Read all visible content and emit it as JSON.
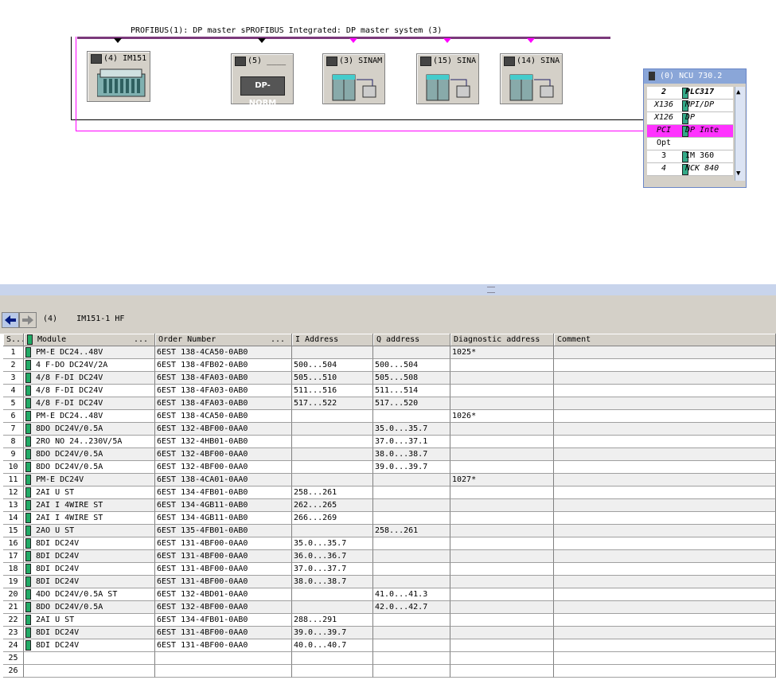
{
  "network": {
    "bus_label": "PROFIBUS(1): DP master sPROFIBUS Integrated: DP master system (3)",
    "stations": [
      {
        "id": "im151",
        "title": "(4) IM151"
      },
      {
        "id": "dpnorm",
        "title": "(5) ____",
        "badge": "DP-NORM"
      },
      {
        "id": "sinam",
        "title": "(3) SINAM"
      },
      {
        "id": "sina15",
        "title": "(15) SINA"
      },
      {
        "id": "sina14",
        "title": "(14) SINA"
      }
    ],
    "plc": {
      "title": "(0) NCU 730.2",
      "rows": [
        {
          "slot": "2",
          "name": "PLC317"
        },
        {
          "slot": "X136",
          "name": "MPI/DP"
        },
        {
          "slot": "X126",
          "name": "DP"
        },
        {
          "slot": "PCI",
          "name": "DP Inte"
        },
        {
          "slot": "Opt",
          "name": ""
        },
        {
          "slot": "3",
          "name": "IM 360"
        },
        {
          "slot": "4",
          "name": "NCK 840"
        }
      ]
    }
  },
  "detail": {
    "slot_number": "(4)",
    "station_name": "IM151-1 HF",
    "columns": [
      "S...",
      "Module",
      "...",
      "Order Number",
      "...",
      "I Address",
      "Q address",
      "Diagnostic address",
      "Comment"
    ],
    "rows": [
      {
        "slot": "1",
        "module": "PM-E DC24..48V",
        "order": "6EST 138-4CA50-0AB0",
        "i": "",
        "q": "",
        "diag": "1025*"
      },
      {
        "slot": "2",
        "module": "4 F-DO DC24V/2A",
        "order": "6EST 138-4FB02-0AB0",
        "i": "500...504",
        "q": "500...504",
        "diag": ""
      },
      {
        "slot": "3",
        "module": "4/8 F-DI DC24V",
        "order": "6EST 138-4FA03-0AB0",
        "i": "505...510",
        "q": "505...508",
        "diag": ""
      },
      {
        "slot": "4",
        "module": "4/8 F-DI DC24V",
        "order": "6EST 138-4FA03-0AB0",
        "i": "511...516",
        "q": "511...514",
        "diag": ""
      },
      {
        "slot": "5",
        "module": "4/8 F-DI DC24V",
        "order": "6EST 138-4FA03-0AB0",
        "i": "517...522",
        "q": "517...520",
        "diag": ""
      },
      {
        "slot": "6",
        "module": "PM-E DC24..48V",
        "order": "6EST 138-4CA50-0AB0",
        "i": "",
        "q": "",
        "diag": "1026*"
      },
      {
        "slot": "7",
        "module": "8DO DC24V/0.5A",
        "order": "6EST 132-4BF00-0AA0",
        "i": "",
        "q": "35.0...35.7",
        "diag": ""
      },
      {
        "slot": "8",
        "module": "2RO NO 24..230V/5A",
        "order": "6EST 132-4HB01-0AB0",
        "i": "",
        "q": "37.0...37.1",
        "diag": ""
      },
      {
        "slot": "9",
        "module": "8DO DC24V/0.5A",
        "order": "6EST 132-4BF00-0AA0",
        "i": "",
        "q": "38.0...38.7",
        "diag": ""
      },
      {
        "slot": "10",
        "module": "8DO DC24V/0.5A",
        "order": "6EST 132-4BF00-0AA0",
        "i": "",
        "q": "39.0...39.7",
        "diag": ""
      },
      {
        "slot": "11",
        "module": "PM-E DC24V",
        "order": "6EST 138-4CA01-0AA0",
        "i": "",
        "q": "",
        "diag": "1027*"
      },
      {
        "slot": "12",
        "module": "2AI U ST",
        "order": "6EST 134-4FB01-0AB0",
        "i": "258...261",
        "q": "",
        "diag": ""
      },
      {
        "slot": "13",
        "module": "2AI I 4WIRE ST",
        "order": "6EST 134-4GB11-0AB0",
        "i": "262...265",
        "q": "",
        "diag": ""
      },
      {
        "slot": "14",
        "module": "2AI I 4WIRE ST",
        "order": "6EST 134-4GB11-0AB0",
        "i": "266...269",
        "q": "",
        "diag": ""
      },
      {
        "slot": "15",
        "module": "2AO U ST",
        "order": "6EST 135-4FB01-0AB0",
        "i": "",
        "q": "258...261",
        "diag": ""
      },
      {
        "slot": "16",
        "module": "8DI DC24V",
        "order": "6EST 131-4BF00-0AA0",
        "i": "35.0...35.7",
        "q": "",
        "diag": ""
      },
      {
        "slot": "17",
        "module": "8DI DC24V",
        "order": "6EST 131-4BF00-0AA0",
        "i": "36.0...36.7",
        "q": "",
        "diag": ""
      },
      {
        "slot": "18",
        "module": "8DI DC24V",
        "order": "6EST 131-4BF00-0AA0",
        "i": "37.0...37.7",
        "q": "",
        "diag": ""
      },
      {
        "slot": "19",
        "module": "8DI DC24V",
        "order": "6EST 131-4BF00-0AA0",
        "i": "38.0...38.7",
        "q": "",
        "diag": ""
      },
      {
        "slot": "20",
        "module": "4DO DC24V/0.5A ST",
        "order": "6EST 132-4BD01-0AA0",
        "i": "",
        "q": "41.0...41.3",
        "diag": ""
      },
      {
        "slot": "21",
        "module": "8DO DC24V/0.5A",
        "order": "6EST 132-4BF00-0AA0",
        "i": "",
        "q": "42.0...42.7",
        "diag": ""
      },
      {
        "slot": "22",
        "module": "2AI U ST",
        "order": "6EST 134-4FB01-0AB0",
        "i": "288...291",
        "q": "",
        "diag": ""
      },
      {
        "slot": "23",
        "module": "8DI DC24V",
        "order": "6EST 131-4BF00-0AA0",
        "i": "39.0...39.7",
        "q": "",
        "diag": ""
      },
      {
        "slot": "24",
        "module": "8DI DC24V",
        "order": "6EST 131-4BF00-0AA0",
        "i": "40.0...40.7",
        "q": "",
        "diag": ""
      },
      {
        "slot": "25",
        "module": "",
        "order": "",
        "i": "",
        "q": "",
        "diag": ""
      },
      {
        "slot": "26",
        "module": "",
        "order": "",
        "i": "",
        "q": "",
        "diag": ""
      }
    ]
  }
}
